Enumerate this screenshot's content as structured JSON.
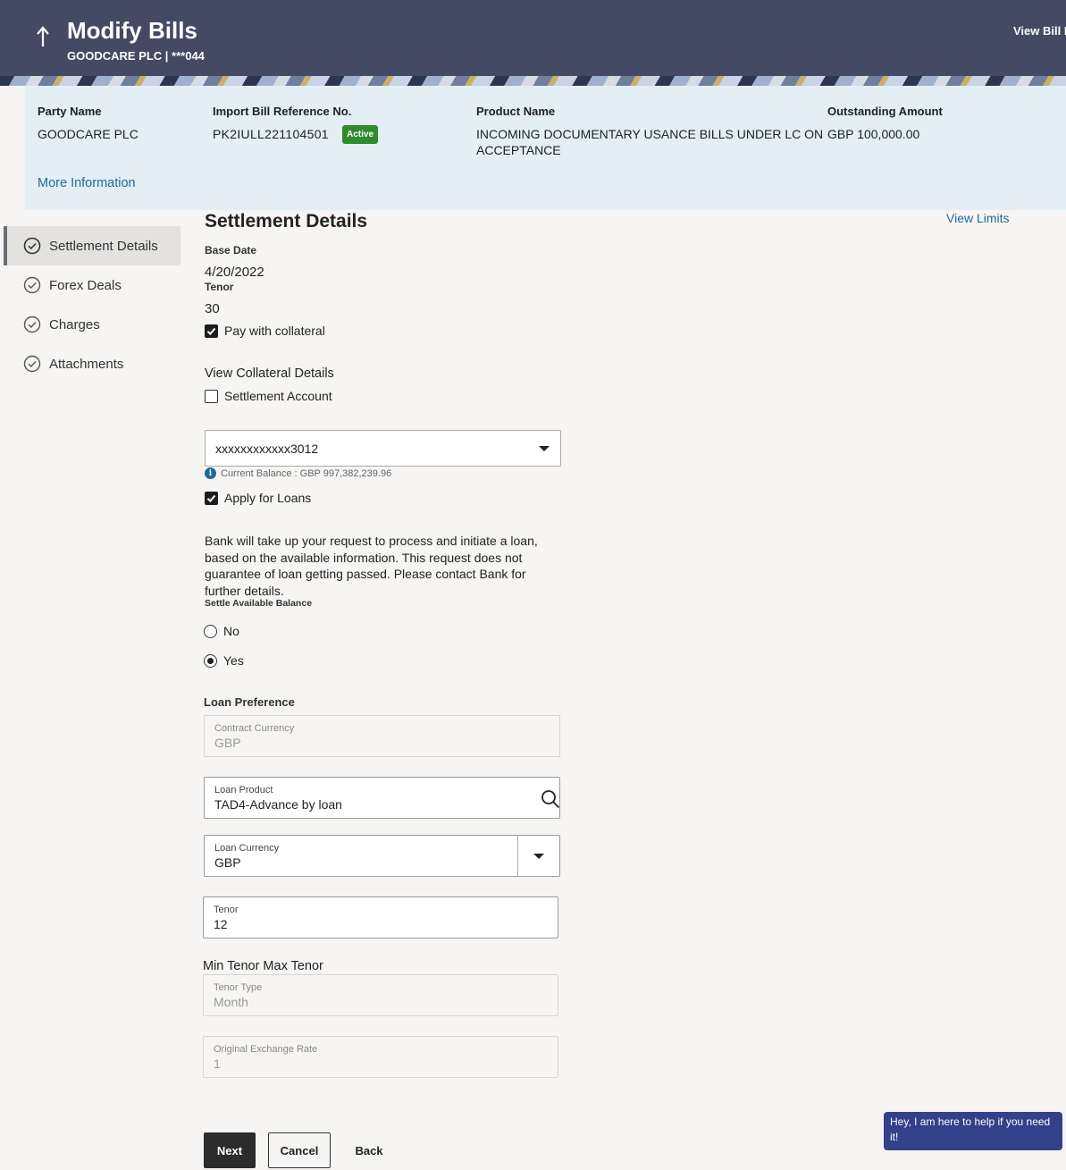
{
  "header": {
    "title": "Modify Bills",
    "subtitle": "GOODCARE PLC | ***044",
    "view_bill_link": "View Bill D"
  },
  "summary": {
    "party_name_label": "Party Name",
    "party_name": "GOODCARE PLC",
    "bill_ref_label": "Import Bill Reference No.",
    "bill_ref": "PK2IULL221104501",
    "status_badge": "Active",
    "product_name_label": "Product Name",
    "product_name": "INCOMING DOCUMENTARY USANCE BILLS UNDER LC ON ACCEPTANCE",
    "outstanding_label": "Outstanding Amount",
    "outstanding_amount": "GBP 100,000.00",
    "more_info_link": "More Information"
  },
  "sidebar": {
    "items": [
      {
        "label": "Settlement Details"
      },
      {
        "label": "Forex Deals"
      },
      {
        "label": "Charges"
      },
      {
        "label": "Attachments"
      }
    ]
  },
  "settlement": {
    "title": "Settlement Details",
    "view_limits_link": "View Limits",
    "base_date_label": "Base Date",
    "base_date": "4/20/2022",
    "tenor_label": "Tenor",
    "tenor": "30",
    "pay_with_collateral_label": "Pay with collateral",
    "pay_with_collateral_checked": true,
    "view_collateral_link": "View Collateral Details",
    "settlement_account_label": "Settlement Account",
    "settlement_account_checked": false,
    "account_selected": "xxxxxxxxxxxx3012",
    "current_balance": "Current Balance : GBP 997,382,239.96",
    "apply_loans_label": "Apply for Loans",
    "apply_loans_checked": true,
    "loan_disclaimer": "Bank will take up your request to process and initiate a loan, based on the available information. This request does not guarantee of loan getting passed. Please contact Bank for further details.",
    "settle_balance_label": "Settle Available Balance",
    "settle_options": [
      {
        "label": "No",
        "selected": false
      },
      {
        "label": "Yes",
        "selected": true
      }
    ]
  },
  "loan": {
    "section_label": "Loan Preference",
    "contract_currency_label": "Contract Currency",
    "contract_currency": "GBP",
    "loan_product_label": "Loan Product",
    "loan_product": "TAD4-Advance by loan",
    "loan_currency_label": "Loan Currency",
    "loan_currency": "GBP",
    "tenor_label": "Tenor",
    "tenor": "12",
    "min_max_tenor": "Min Tenor Max Tenor",
    "tenor_type_label": "Tenor Type",
    "tenor_type": "Month",
    "exchange_rate_label": "Original Exchange Rate",
    "exchange_rate": "1"
  },
  "actions": {
    "next": "Next",
    "cancel": "Cancel",
    "back": "Back"
  },
  "chat": {
    "message": "Hey, I am here to help if you need it!"
  },
  "colors": {
    "header_bg": "#444a63",
    "info_panel_bg": "#e3eef5",
    "link": "#1f6b95",
    "active_badge": "#2e8b2e",
    "chat_bg": "#33418a"
  }
}
